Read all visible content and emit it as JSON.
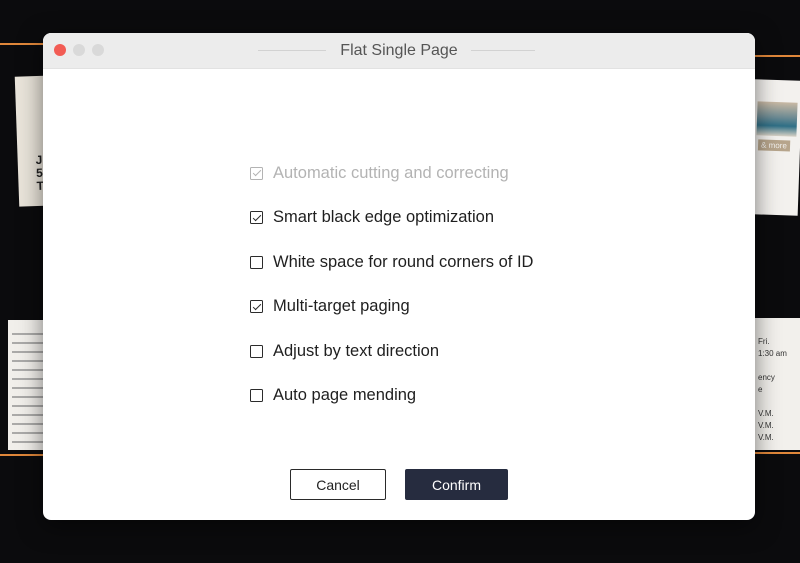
{
  "window": {
    "title": "Flat Single Page"
  },
  "options": [
    {
      "label": "Automatic cutting and correcting",
      "checked": true,
      "disabled": true
    },
    {
      "label": "Smart black edge optimization",
      "checked": true,
      "disabled": false
    },
    {
      "label": "White space for round corners of ID",
      "checked": false,
      "disabled": false
    },
    {
      "label": "Multi-target paging",
      "checked": true,
      "disabled": false
    },
    {
      "label": "Adjust by text direction",
      "checked": false,
      "disabled": false
    },
    {
      "label": "Auto page mending",
      "checked": false,
      "disabled": false
    }
  ],
  "buttons": {
    "cancel_label": "Cancel",
    "confirm_label": "Confirm"
  },
  "background": {
    "card_a_text": "J\n5:\nTu",
    "card_c_caption": "& more",
    "card_d_text": "Fri.\n1:30 am\n\nency\ne\n\nV.M.\nV.M.\nV.M."
  },
  "colors": {
    "accent_button": "#262c3f",
    "close_button": "#f25c54",
    "guide_line": "#e0873a"
  }
}
